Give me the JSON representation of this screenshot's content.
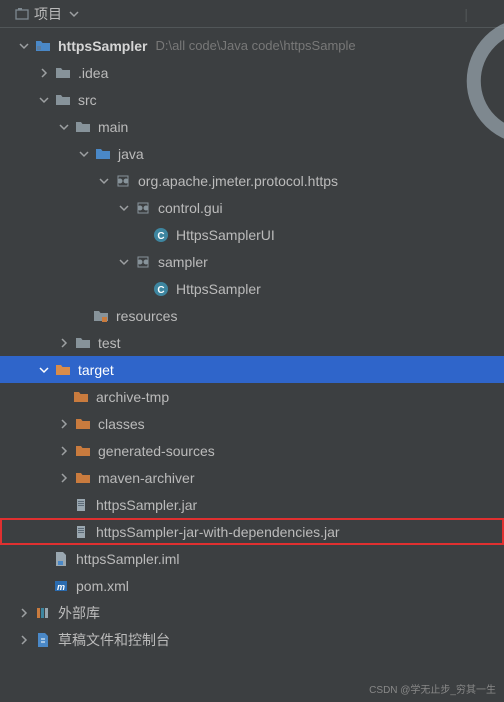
{
  "toolbar": {
    "tab_label": "项目"
  },
  "tree": {
    "root": {
      "name": "httpsSampler",
      "path": "D:\\all code\\Java code\\httpsSample"
    },
    "idea": ".idea",
    "src": "src",
    "main": "main",
    "java": "java",
    "pkg": "org.apache.jmeter.protocol.https",
    "control_gui": "control.gui",
    "https_sampler_ui": "HttpsSamplerUI",
    "sampler": "sampler",
    "https_sampler": "HttpsSampler",
    "resources": "resources",
    "test": "test",
    "target": "target",
    "archive_tmp": "archive-tmp",
    "classes": "classes",
    "generated_sources": "generated-sources",
    "maven_archiver": "maven-archiver",
    "jar1": "httpsSampler.jar",
    "jar2": "httpsSampler-jar-with-dependencies.jar",
    "iml": "httpsSampler.iml",
    "pom": "pom.xml",
    "ext_lib": "外部库",
    "scratches": "草稿文件和控制台"
  },
  "watermark": "CSDN @学无止步_穷其一生"
}
